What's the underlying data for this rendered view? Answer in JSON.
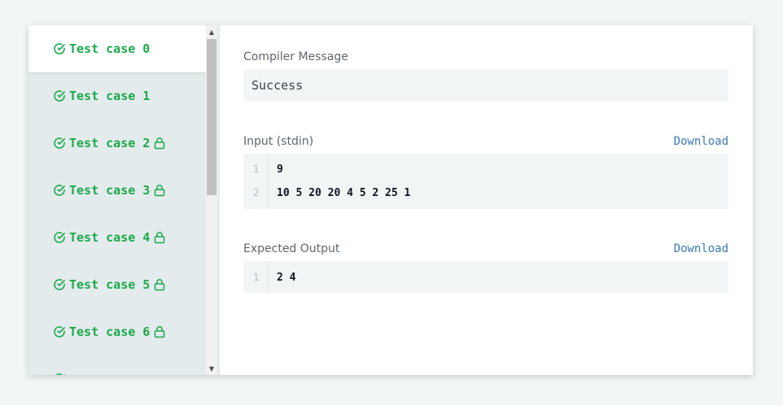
{
  "test_cases": [
    {
      "label": "Test case 0",
      "locked": false,
      "active": true
    },
    {
      "label": "Test case 1",
      "locked": false,
      "active": false
    },
    {
      "label": "Test case 2",
      "locked": true,
      "active": false
    },
    {
      "label": "Test case 3",
      "locked": true,
      "active": false
    },
    {
      "label": "Test case 4",
      "locked": true,
      "active": false
    },
    {
      "label": "Test case 5",
      "locked": true,
      "active": false
    },
    {
      "label": "Test case 6",
      "locked": true,
      "active": false
    }
  ],
  "compiler": {
    "label": "Compiler Message",
    "message": "Success"
  },
  "input": {
    "label": "Input (stdin)",
    "download_label": "Download",
    "lines": [
      {
        "number": "1",
        "text": "9"
      },
      {
        "number": "2",
        "text": "10 5 20 20 4 5 2 25 1"
      }
    ]
  },
  "expected": {
    "label": "Expected Output",
    "download_label": "Download",
    "lines": [
      {
        "number": "1",
        "text": "2 4"
      }
    ]
  },
  "colors": {
    "success_green": "#1ba94c",
    "link_blue": "#3a7ab8",
    "sidebar_bg": "#e4ebec"
  },
  "icons": {
    "check": "circle-check-icon",
    "lock": "lock-icon",
    "scroll_up": "arrow-up-icon",
    "scroll_down": "arrow-down-icon"
  }
}
